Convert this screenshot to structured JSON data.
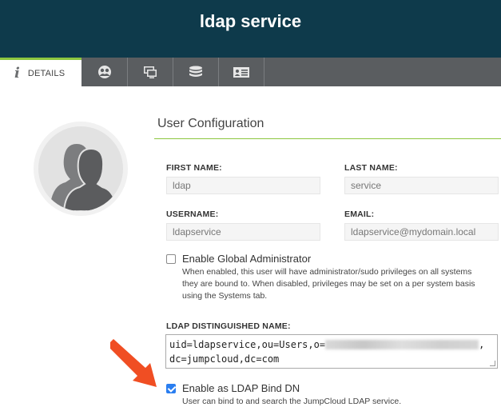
{
  "header": {
    "title": "ldap service"
  },
  "tabs": [
    {
      "label": "DETAILS",
      "icon": "info-icon",
      "active": true
    },
    {
      "label": "",
      "icon": "groups-icon"
    },
    {
      "label": "",
      "icon": "systems-icon"
    },
    {
      "label": "",
      "icon": "directories-icon"
    },
    {
      "label": "",
      "icon": "id-card-icon"
    }
  ],
  "section": {
    "title": "User Configuration"
  },
  "form": {
    "first_name": {
      "label": "FIRST NAME:",
      "value": "ldap"
    },
    "last_name": {
      "label": "LAST NAME:",
      "value": "service"
    },
    "username": {
      "label": "USERNAME:",
      "value": "ldapservice"
    },
    "email": {
      "label": "EMAIL:",
      "value": "ldapservice@mydomain.local"
    },
    "global_admin": {
      "label": "Enable Global Administrator",
      "checked": false,
      "help_lines": [
        "When enabled, this user will have administrator/sudo privileges on all systems",
        "they are bound to. When disabled, privileges may be set on a per system basis",
        "using the Systems tab."
      ]
    },
    "ldap_dn": {
      "label": "LDAP DISTINGUISHED NAME:",
      "line1_prefix": "uid=ldapservice,ou=Users,o=",
      "line1_suffix": ",",
      "line2": "dc=jumpcloud,dc=com"
    },
    "ldap_bind": {
      "label": "Enable as LDAP Bind DN",
      "checked": true,
      "help": "User can bind to and search the JumpCloud LDAP service."
    }
  },
  "colors": {
    "header_bg": "#0e3a4b",
    "tabbar_bg": "#5a5d60",
    "accent_green": "#8cc63f",
    "checkbox_blue": "#2a7ef0",
    "arrow_red": "#f04e23"
  }
}
